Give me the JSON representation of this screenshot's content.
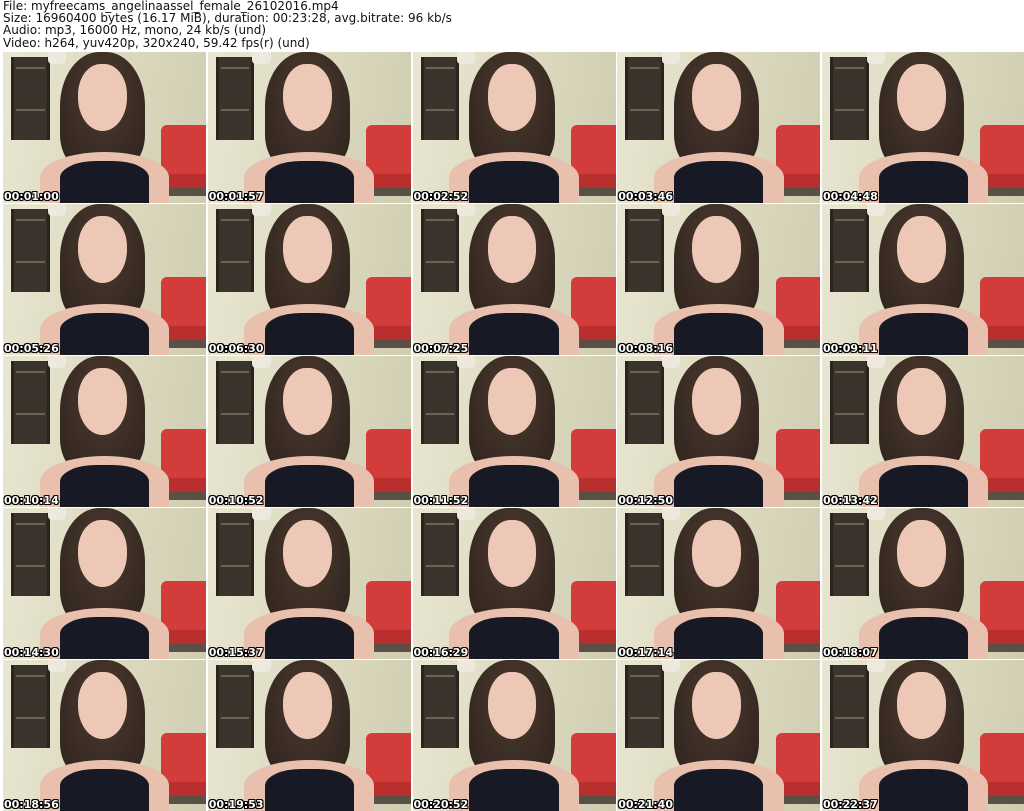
{
  "header": {
    "file_line": "File: myfreecams_angelinaassel_female_26102016.mp4",
    "size_line": "Size: 16960400 bytes (16.17 MiB), duration: 00:23:28, avg.bitrate: 96 kb/s",
    "audio_line": "Audio: mp3, 16000 Hz, mono, 24 kb/s (und)",
    "video_line": "Video: h264, yuv420p, 320x240, 59.42 fps(r) (und)"
  },
  "thumbnails": [
    {
      "timestamp": "00:01:00"
    },
    {
      "timestamp": "00:01:57"
    },
    {
      "timestamp": "00:02:52"
    },
    {
      "timestamp": "00:03:46"
    },
    {
      "timestamp": "00:04:48"
    },
    {
      "timestamp": "00:05:26"
    },
    {
      "timestamp": "00:06:30"
    },
    {
      "timestamp": "00:07:25"
    },
    {
      "timestamp": "00:08:16"
    },
    {
      "timestamp": "00:09:11"
    },
    {
      "timestamp": "00:10:14"
    },
    {
      "timestamp": "00:10:52"
    },
    {
      "timestamp": "00:11:52"
    },
    {
      "timestamp": "00:12:50"
    },
    {
      "timestamp": "00:13:42"
    },
    {
      "timestamp": "00:14:30"
    },
    {
      "timestamp": "00:15:37"
    },
    {
      "timestamp": "00:16:29"
    },
    {
      "timestamp": "00:17:14"
    },
    {
      "timestamp": "00:18:07"
    },
    {
      "timestamp": "00:18:56"
    },
    {
      "timestamp": "00:19:53"
    },
    {
      "timestamp": "00:20:52"
    },
    {
      "timestamp": "00:21:40"
    },
    {
      "timestamp": "00:22:37"
    }
  ]
}
